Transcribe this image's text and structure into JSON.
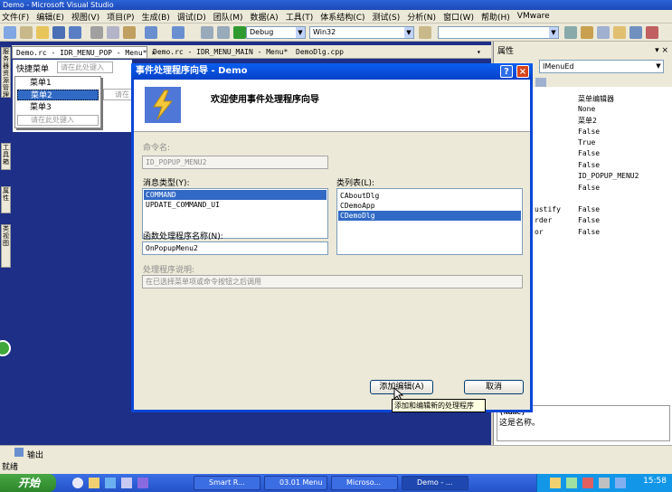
{
  "window": {
    "title": "Demo - Microsoft Visual Studio"
  },
  "menu": [
    "文件(F)",
    "编辑(E)",
    "视图(V)",
    "项目(P)",
    "生成(B)",
    "调试(D)",
    "团队(M)",
    "数据(A)",
    "工具(T)",
    "体系结构(C)",
    "测试(S)",
    "分析(N)",
    "窗口(W)",
    "帮助(H)",
    "VMware"
  ],
  "toolbar": {
    "config": "Debug",
    "platform": "Win32"
  },
  "tabs": [
    "Demo.rc - IDR_MENU_POP - Menu*",
    "Demo.rc - IDR_MENU_MAIN - Menu*",
    "DemoDlg.cpp"
  ],
  "menu_editor": {
    "bar_item": "快捷菜单",
    "bar_placeholder": "请在此处键入",
    "items": [
      "菜单1",
      "菜单2",
      "菜单3"
    ],
    "item_placeholder": "请在此处键入",
    "side_placeholder": "请在"
  },
  "left_tabs": [
    "服务器资源管理器",
    "工具箱",
    "属性",
    "类视图"
  ],
  "properties": {
    "title": "属性",
    "object": "IMenuEd",
    "rows": [
      {
        "name": "",
        "value": "菜单编辑器"
      },
      {
        "name": "",
        "value": "None"
      },
      {
        "name": "",
        "value": "菜单2"
      },
      {
        "name": "",
        "value": "False"
      },
      {
        "name": "",
        "value": "True"
      },
      {
        "name": "",
        "value": "False"
      },
      {
        "name": "",
        "value": "False"
      },
      {
        "name": "",
        "value": "ID_POPUP_MENU2"
      },
      {
        "name": "",
        "value": "False"
      },
      {
        "name": "",
        "value": ""
      },
      {
        "name": "ustify",
        "value": "False"
      },
      {
        "name": "rder",
        "value": "False"
      },
      {
        "name": "or",
        "value": "False"
      }
    ],
    "desc_name": "(Name)",
    "desc_text": "这是名称。"
  },
  "dialog": {
    "title": "事件处理程序向导 - Demo",
    "header": "欢迎使用事件处理程序向导",
    "command_name_label": "命令名:",
    "command_name": "ID_POPUP_MENU2",
    "message_type_label": "消息类型(Y):",
    "message_types": [
      "COMMAND",
      "UPDATE_COMMAND_UI"
    ],
    "class_list_label": "类列表(L):",
    "classes": [
      "CAboutDlg",
      "CDemoApp",
      "CDemoDlg"
    ],
    "handler_name_label": "函数处理程序名称(N):",
    "handler_name": "OnPopupMenu2",
    "handler_desc_label": "处理程序说明:",
    "handler_desc": "在已选择菜单项或命令按钮之后调用",
    "add_edit": "添加编辑(A)",
    "cancel": "取消",
    "tooltip": "添加和编辑新的处理程序"
  },
  "output": {
    "label": "输出"
  },
  "status": {
    "text": "就绪"
  },
  "taskbar": {
    "start": "开始",
    "tasks": [
      "Smart R...",
      "03.01 Menu",
      "Microso...",
      "Demo - ..."
    ],
    "clock": "15:58"
  }
}
